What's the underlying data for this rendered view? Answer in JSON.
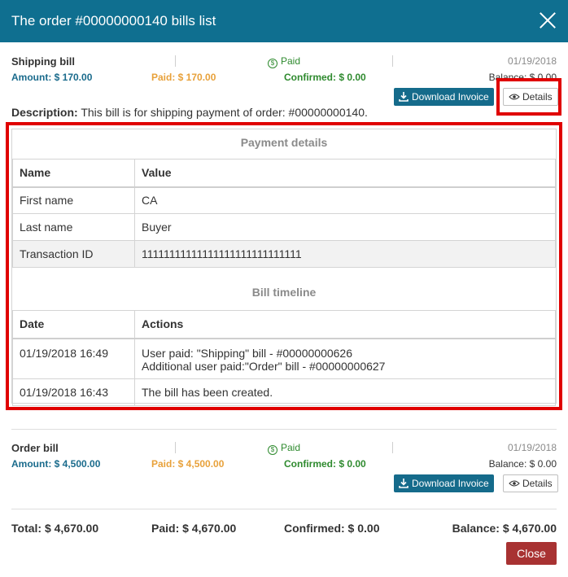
{
  "header": {
    "title": "The order #00000000140 bills list"
  },
  "bills": [
    {
      "name": "Shipping bill",
      "status": "Paid",
      "date": "01/19/2018",
      "amount": "Amount: $ 170.00",
      "paid": "Paid: $ 170.00",
      "confirmed": "Confirmed: $ 0.00",
      "balance": "Balance: $ 0.00",
      "download_label": "Download Invoice",
      "details_label": "Details",
      "description_label": "Description:",
      "description_text": " This bill is for shipping payment of order: #00000000140.",
      "payment_details": {
        "title": "Payment details",
        "col_name": "Name",
        "col_value": "Value",
        "rows": [
          {
            "name": "First name",
            "value": "CA"
          },
          {
            "name": "Last name",
            "value": "Buyer"
          },
          {
            "name": "Transaction ID",
            "value": "11111111111111111111111111111"
          }
        ]
      },
      "timeline": {
        "title": "Bill timeline",
        "col_date": "Date",
        "col_actions": "Actions",
        "rows": [
          {
            "date": "01/19/2018 16:49",
            "action_1": "User paid: \"Shipping\" bill - #00000000626",
            "action_2": "Additional user paid:\"Order\" bill - #00000000627"
          },
          {
            "date": "01/19/2018 16:43",
            "action_1": "The bill has been created."
          }
        ]
      }
    },
    {
      "name": "Order bill",
      "status": "Paid",
      "date": "01/19/2018",
      "amount": "Amount: $ 4,500.00",
      "paid": "Paid: $ 4,500.00",
      "confirmed": "Confirmed: $ 0.00",
      "balance": "Balance: $ 0.00",
      "download_label": "Download Invoice",
      "details_label": "Details"
    }
  ],
  "totals": {
    "total": "Total: $ 4,670.00",
    "paid": "Paid: $ 4,670.00",
    "confirmed": "Confirmed: $ 0.00",
    "balance": "Balance: $ 4,670.00"
  },
  "footer": {
    "close_label": "Close"
  },
  "colors": {
    "header": "#0f6f90",
    "amount": "#1a6b8c",
    "paid": "#e8a13a",
    "confirmed": "#2e8a2e",
    "highlight": "#e00000",
    "close": "#a83232"
  },
  "icons": {
    "paid": "dollar-circle-icon",
    "download": "download-icon",
    "details": "eye-icon",
    "close": "close-icon"
  }
}
